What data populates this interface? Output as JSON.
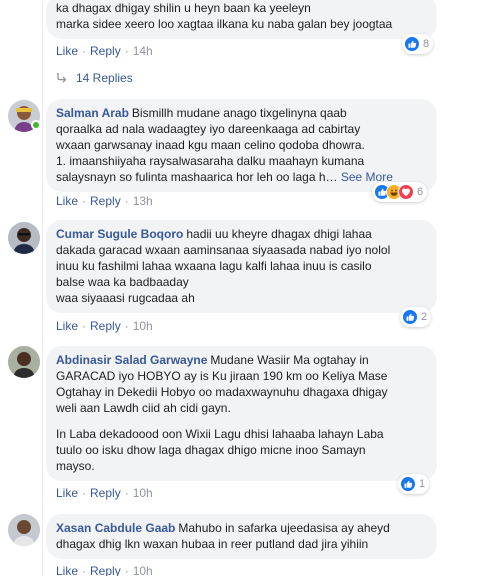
{
  "comments": [
    {
      "lines": [
        "ka dhagax dhigay shilin u heyn baan ka yeeleyn",
        "marka sidee xeero loo xagtaa ilkana ku naba galan bey joogtaa"
      ],
      "like_label": "Like",
      "reply_label": "Reply",
      "time": "14h",
      "reaction_count": "8"
    },
    {
      "author": "Salman Arab",
      "lines": [
        "Bismillh mudane anago tixgelinyna qaab",
        "qoraalka ad nala wadaagtey iyo dareenkaaga ad cabirtay",
        "wxaan garwsanay inaad kgu maan celino qodoba dhowra.",
        "1. imaanshiiyaha raysalwasaraha dalku maahayn kumana",
        "salaysnayn so fulinta mashaarica hor leh oo laga h…"
      ],
      "see_more": "See More",
      "like_label": "Like",
      "reply_label": "Reply",
      "time": "13h",
      "reaction_count": "6"
    },
    {
      "author": "Cumar Sugule Boqoro",
      "lines": [
        "hadii uu kheyre dhagax dhigi lahaa",
        "dakada garacad wxaan aaminsanaa siyaasada nabad iyo nolol",
        "inuu ku fashilmi lahaa wxaana lagu kalfi lahaa inuu is casilo",
        "balse waa ka badbaaday",
        "waa siyaaasi rugcadaa ah"
      ],
      "like_label": "Like",
      "reply_label": "Reply",
      "time": "10h",
      "reaction_count": "2"
    },
    {
      "author": "Abdinasir Salad Garwayne",
      "lines": [
        "Mudane Wasiir Ma ogtahay in",
        "GARACAD iyo HOBYO ay is Ku jiraan 190 km oo Keliya Mase",
        "Ogtahay in Dekedii Hobyo oo madaxwaynuhu dhagaxa dhigay",
        "weli aan Lawdh ciid ah cidi gayn."
      ],
      "lines2": [
        "In Laba dekadoood oon Wixii Lagu dhisi lahaaba lahayn Laba",
        "tuulo oo isku dhow laga dhagax dhigo micne inoo Samayn",
        "mayso."
      ],
      "like_label": "Like",
      "reply_label": "Reply",
      "time": "10h",
      "reaction_count": "1"
    },
    {
      "author": "Xasan Cabdule Gaab",
      "lines": [
        "Mahubo in safarka ujeedasisa ay aheyd",
        "dhagax dhig lkn waxan hubaa in reer putland dad jira yihiin"
      ],
      "like_label": "Like",
      "reply_label": "Reply",
      "time": "10h"
    }
  ],
  "replies_link": "14 Replies",
  "colors": {
    "link": "#385898",
    "bubble": "#f2f3f5",
    "like_blue": "#1877f2",
    "love_red": "#f33e58",
    "haha_yellow": "#f7b125",
    "online_green": "#42b72a"
  },
  "icons": [
    "like-icon",
    "love-icon",
    "haha-icon",
    "reply-arrow-icon",
    "online-status-dot"
  ]
}
